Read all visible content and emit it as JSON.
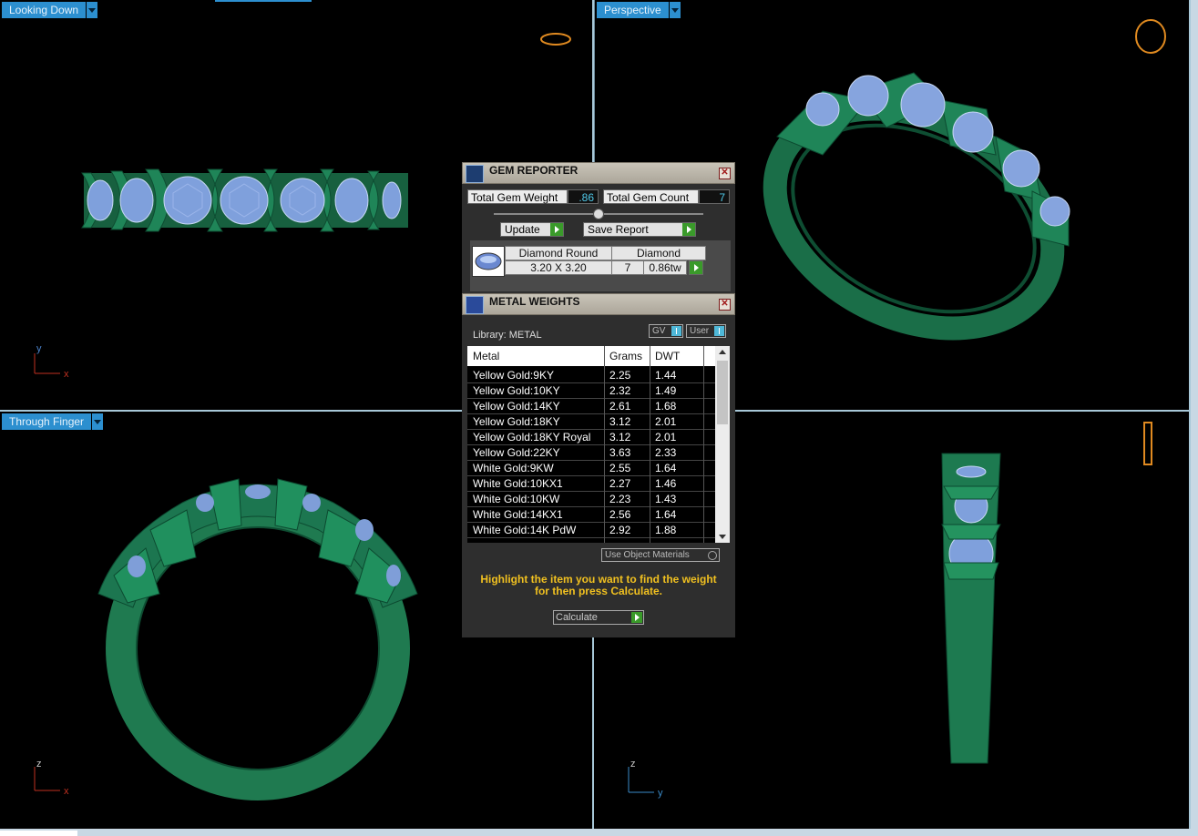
{
  "viewports": {
    "top_left": {
      "label": "Looking Down",
      "axis_a": "y",
      "axis_b": "x"
    },
    "top_right": {
      "label": "Perspective"
    },
    "bottom_left": {
      "label": "Through Finger",
      "axis_a": "z",
      "axis_b": "x"
    },
    "bottom_right": {
      "axis_a": "z",
      "axis_b": "y"
    }
  },
  "gem_reporter": {
    "title": "GEM REPORTER",
    "total_weight_label": "Total Gem Weight",
    "total_weight_value": ".86",
    "total_count_label": "Total Gem Count",
    "total_count_value": "7",
    "update_label": "Update",
    "save_report_label": "Save Report",
    "gem": {
      "shape": "Diamond Round",
      "material": "Diamond",
      "size": "3.20 X 3.20",
      "count": "7",
      "weight": "0.86tw"
    }
  },
  "metal_weights": {
    "title": "METAL WEIGHTS",
    "library": "Library: METAL",
    "gv_label": "GV",
    "user_label": "User",
    "columns": [
      "Metal",
      "Grams",
      "DWT"
    ],
    "rows": [
      {
        "metal": "Yellow Gold:9KY",
        "grams": "2.25",
        "dwt": "1.44"
      },
      {
        "metal": "Yellow Gold:10KY",
        "grams": "2.32",
        "dwt": "1.49"
      },
      {
        "metal": "Yellow Gold:14KY",
        "grams": "2.61",
        "dwt": "1.68"
      },
      {
        "metal": "Yellow Gold:18KY",
        "grams": "3.12",
        "dwt": "2.01"
      },
      {
        "metal": "Yellow Gold:18KY Royal",
        "grams": "3.12",
        "dwt": "2.01"
      },
      {
        "metal": "Yellow Gold:22KY",
        "grams": "3.63",
        "dwt": "2.33"
      },
      {
        "metal": "White Gold:9KW",
        "grams": "2.55",
        "dwt": "1.64"
      },
      {
        "metal": "White Gold:10KX1",
        "grams": "2.27",
        "dwt": "1.46"
      },
      {
        "metal": "White Gold:10KW",
        "grams": "2.23",
        "dwt": "1.43"
      },
      {
        "metal": "White Gold:14KX1",
        "grams": "2.56",
        "dwt": "1.64"
      },
      {
        "metal": "White Gold:14K PdW",
        "grams": "2.92",
        "dwt": "1.88"
      }
    ],
    "use_object_materials": "Use Object Materials",
    "hint": "Highlight the item you want to find the weight for then press Calculate.",
    "calculate_label": "Calculate"
  },
  "colors": {
    "viewport_label_bg": "#2c8fcf",
    "metal_green": "#1e7a52",
    "gem_blue": "#8ea8e0",
    "hint_yellow": "#f0c020"
  }
}
